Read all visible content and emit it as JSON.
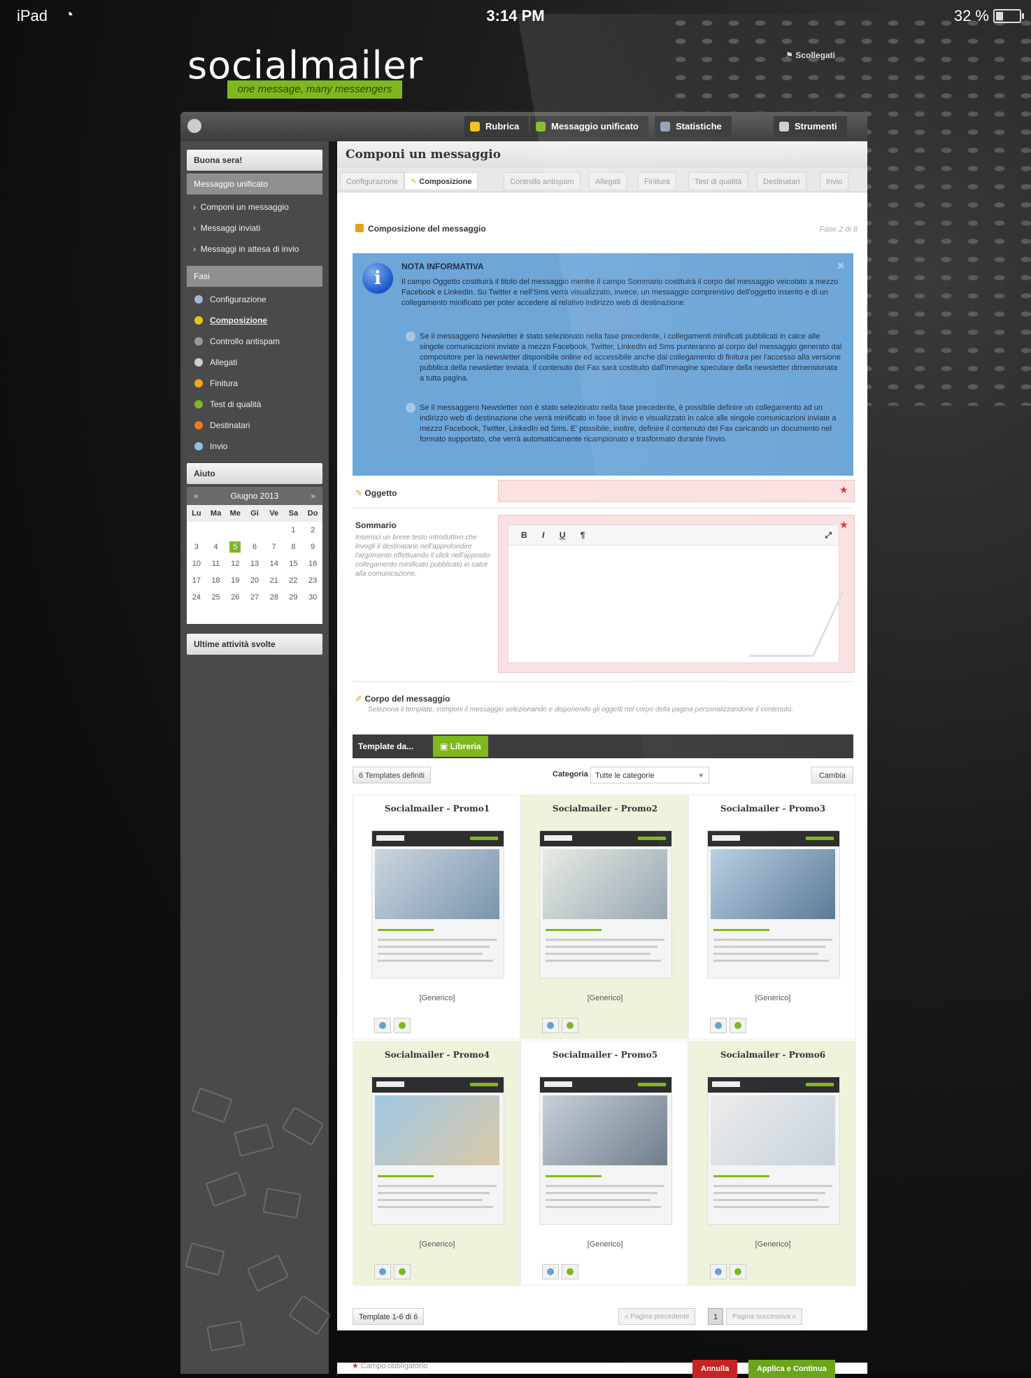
{
  "status_bar": {
    "device": "iPad",
    "time": "3:14 PM",
    "battery": "32 %"
  },
  "brand": {
    "logo_text": "socialmailer",
    "tagline": "one message, many messengers",
    "logout": "Scollegati",
    "accent_color": "#7fb81e"
  },
  "top_nav": [
    {
      "label": "Rubrica",
      "icon": "address-book-icon",
      "color": "#f0c419"
    },
    {
      "label": "Messaggio unificato",
      "icon": "message-icon",
      "color": "#7fb81e"
    },
    {
      "label": "Statistiche",
      "icon": "chart-icon",
      "color": "#8fa0b8"
    },
    {
      "label": "Strumenti",
      "icon": "wrench-icon",
      "color": "#cfcfcf"
    }
  ],
  "sidebar": {
    "greeting": "Buona sera!",
    "section_title": "Messaggio unificato",
    "links": [
      "Componi un messaggio",
      "Messaggi inviati",
      "Messaggi in attesa di invio"
    ],
    "phases_title": "Fasi",
    "phases": [
      {
        "label": "Configurazione",
        "color": "#9db7d8"
      },
      {
        "label": "Composizione",
        "color": "#e7c21a"
      },
      {
        "label": "Controllo antispam",
        "color": "#999999"
      },
      {
        "label": "Allegati",
        "color": "#cfcfcf"
      },
      {
        "label": "Finitura",
        "color": "#f0a51b"
      },
      {
        "label": "Test di qualità",
        "color": "#7fb81e"
      },
      {
        "label": "Destinatari",
        "color": "#f07a1b"
      },
      {
        "label": "Invio",
        "color": "#8fc1e0"
      }
    ],
    "help_title": "Aiuto",
    "calendar": {
      "month": "Giugno 2013",
      "prev": "«",
      "next": "»",
      "weekdays": [
        "Lu",
        "Ma",
        "Me",
        "Gi",
        "Ve",
        "Sa",
        "Do"
      ],
      "weeks": [
        [
          "",
          "",
          "",
          "",
          "",
          "1",
          "2"
        ],
        [
          "3",
          "4",
          "5",
          "6",
          "7",
          "8",
          "9"
        ],
        [
          "10",
          "11",
          "12",
          "13",
          "14",
          "15",
          "16"
        ],
        [
          "17",
          "18",
          "19",
          "20",
          "21",
          "22",
          "23"
        ],
        [
          "24",
          "25",
          "26",
          "27",
          "28",
          "29",
          "30"
        ]
      ],
      "today": "5"
    },
    "recent_title": "Ultime attività svolte"
  },
  "main": {
    "title": "Componi un messaggio",
    "steps": [
      "Configurazione",
      "Composizione",
      "Controllo antispam",
      "Allegati",
      "Finitura",
      "Test di qualità",
      "Destinatari",
      "Invio"
    ],
    "active_step": "Composizione",
    "section_title": "Composizione del messaggio",
    "phase_indicator": "Fase 2 di 8",
    "info": {
      "title": "NOTA INFORMATIVA",
      "close": "✖",
      "p1": "Il campo Oggetto costituirà il titolo del messaggio mentre il campo Sommario costituirà il corpo del messaggio veicolato a mezzo Facebook e LinkedIn. Su Twitter e nell'Sms verrà visualizzato, invece, un messaggio comprensivo dell'oggetto inserito e di un collegamento minificato per poter accedere al relativo indirizzo web di destinazione.",
      "p2": "Se il messaggero Newsletter è stato selezionato nella fase precedente, i collegamenti minificati pubblicati in calce alle singole comunicazioni inviate a mezzo Facebook, Twitter, LinkedIn ed Sms punteranno al corpo del messaggio generato dal compositore per la newsletter disponibile online ed accessibile anche dal collegamento di finitura per l'accesso alla versione pubblica della newsletter inviata. Il contenuto del Fax sarà costituito dall'immagine speculare della newsletter dimensionata a tutta pagina.",
      "p3": "Se il messaggero Newsletter non è stato selezionato nella fase precedente, è possibile definire un collegamento ad un indirizzo web di destinazione che verrà minificato in fase di invio e visualizzato in calce alle singole comunicazioni inviate a mezzo Facebook, Twitter, LinkedIn ed Sms. E' possibile, inoltre, definire il contenuto del Fax caricando un documento nel formato supportato, che verrà automaticamente ricampionato e trasformato durante l'invio."
    },
    "subject_label": "Oggetto",
    "summary_label": "Sommario",
    "summary_desc": "Inserisci un breve testo introduttivo che invogli il destinatario nell'approfondire l'argomento effettuando il click nell'apposito collegamento minificato pubblicato in calce alla comunicazione.",
    "editor_buttons": [
      "B",
      "I",
      "U",
      "¶"
    ],
    "body_label": "Corpo del messaggio",
    "body_desc": "Seleziona il template, componi il messaggio selezionando e disponendo gli oggetti nel corpo della pagina personalizzandone il contenuto.",
    "template_from": "Template da...",
    "library": "Libreria",
    "templates_count": "6 Templates definiti",
    "category_label": "Categoria",
    "category_value": "Tutte le categorie",
    "change_button": "Cambia",
    "templates": [
      {
        "name": "Socialmailer - Promo1",
        "category": "[Generico]"
      },
      {
        "name": "Socialmailer - Promo2",
        "category": "[Generico]"
      },
      {
        "name": "Socialmailer - Promo3",
        "category": "[Generico]"
      },
      {
        "name": "Socialmailer - Promo4",
        "category": "[Generico]"
      },
      {
        "name": "Socialmailer - Promo5",
        "category": "[Generico]"
      },
      {
        "name": "Socialmailer - Promo6",
        "category": "[Generico]"
      }
    ],
    "pager": {
      "range": "Template 1-6 di 6",
      "prev": "« Pagina precedente",
      "page": "1",
      "next": "Pagina successiva »"
    }
  },
  "footer": {
    "required_note": "Campo obbligatorio",
    "cancel": "Annulla",
    "apply": "Applica e Continua"
  }
}
